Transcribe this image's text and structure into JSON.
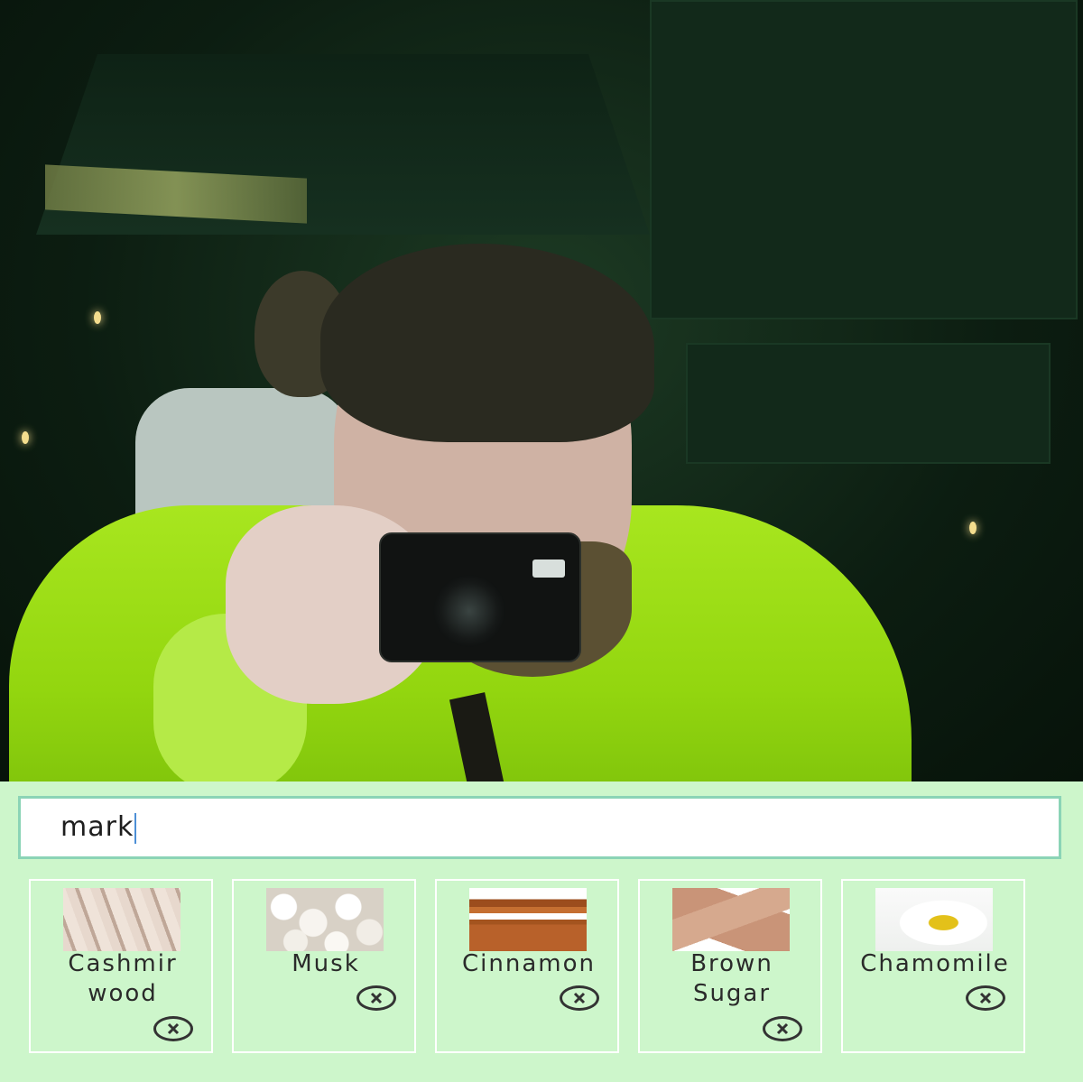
{
  "search": {
    "value": "mark"
  },
  "ingredients": [
    {
      "name": "Cashmir wood",
      "line1": "Cashmir",
      "line2": "wood",
      "image": "cashmere-fabric-image"
    },
    {
      "name": "Musk",
      "line1": "Musk",
      "line2": "",
      "image": "musk-crystals-image"
    },
    {
      "name": "Cinnamon",
      "line1": "Cinnamon",
      "line2": "",
      "image": "cinnamon-sticks-image"
    },
    {
      "name": "Brown Sugar",
      "line1": "Brown",
      "line2": "Sugar",
      "image": "brown-sugar-cubes-image"
    },
    {
      "name": "Chamomile",
      "line1": "Chamomile",
      "line2": "",
      "image": "chamomile-flower-image"
    }
  ],
  "icons": {
    "remove": "close-circle-icon"
  },
  "colors": {
    "panel_background": "#cdf6cb",
    "search_border": "#8bd4b6",
    "card_border": "#ffffff",
    "caret": "#4d8fd6"
  }
}
